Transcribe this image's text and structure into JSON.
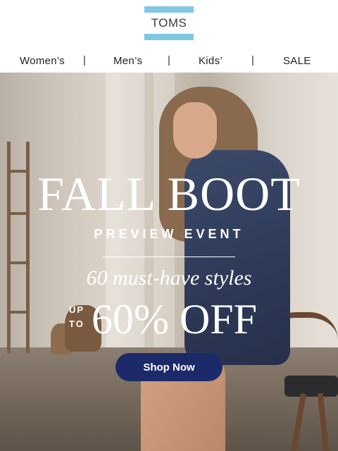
{
  "brand": {
    "logo_text": "TOMS",
    "stripe_color": "#7ec8e3"
  },
  "nav": {
    "items": [
      {
        "label": "Women’s"
      },
      {
        "label": "Men’s"
      },
      {
        "label": "Kids’"
      },
      {
        "label": "SALE"
      }
    ],
    "separator": "|"
  },
  "hero": {
    "headline": "FALL BOOT",
    "subheadline": "PREVIEW EVENT",
    "tagline": "60 must-have styles",
    "offer_prefix_1": "UP",
    "offer_prefix_2": "TO",
    "offer_value": "60% OFF",
    "cta_label": "Shop Now",
    "cta_color": "#1c2a6a"
  }
}
